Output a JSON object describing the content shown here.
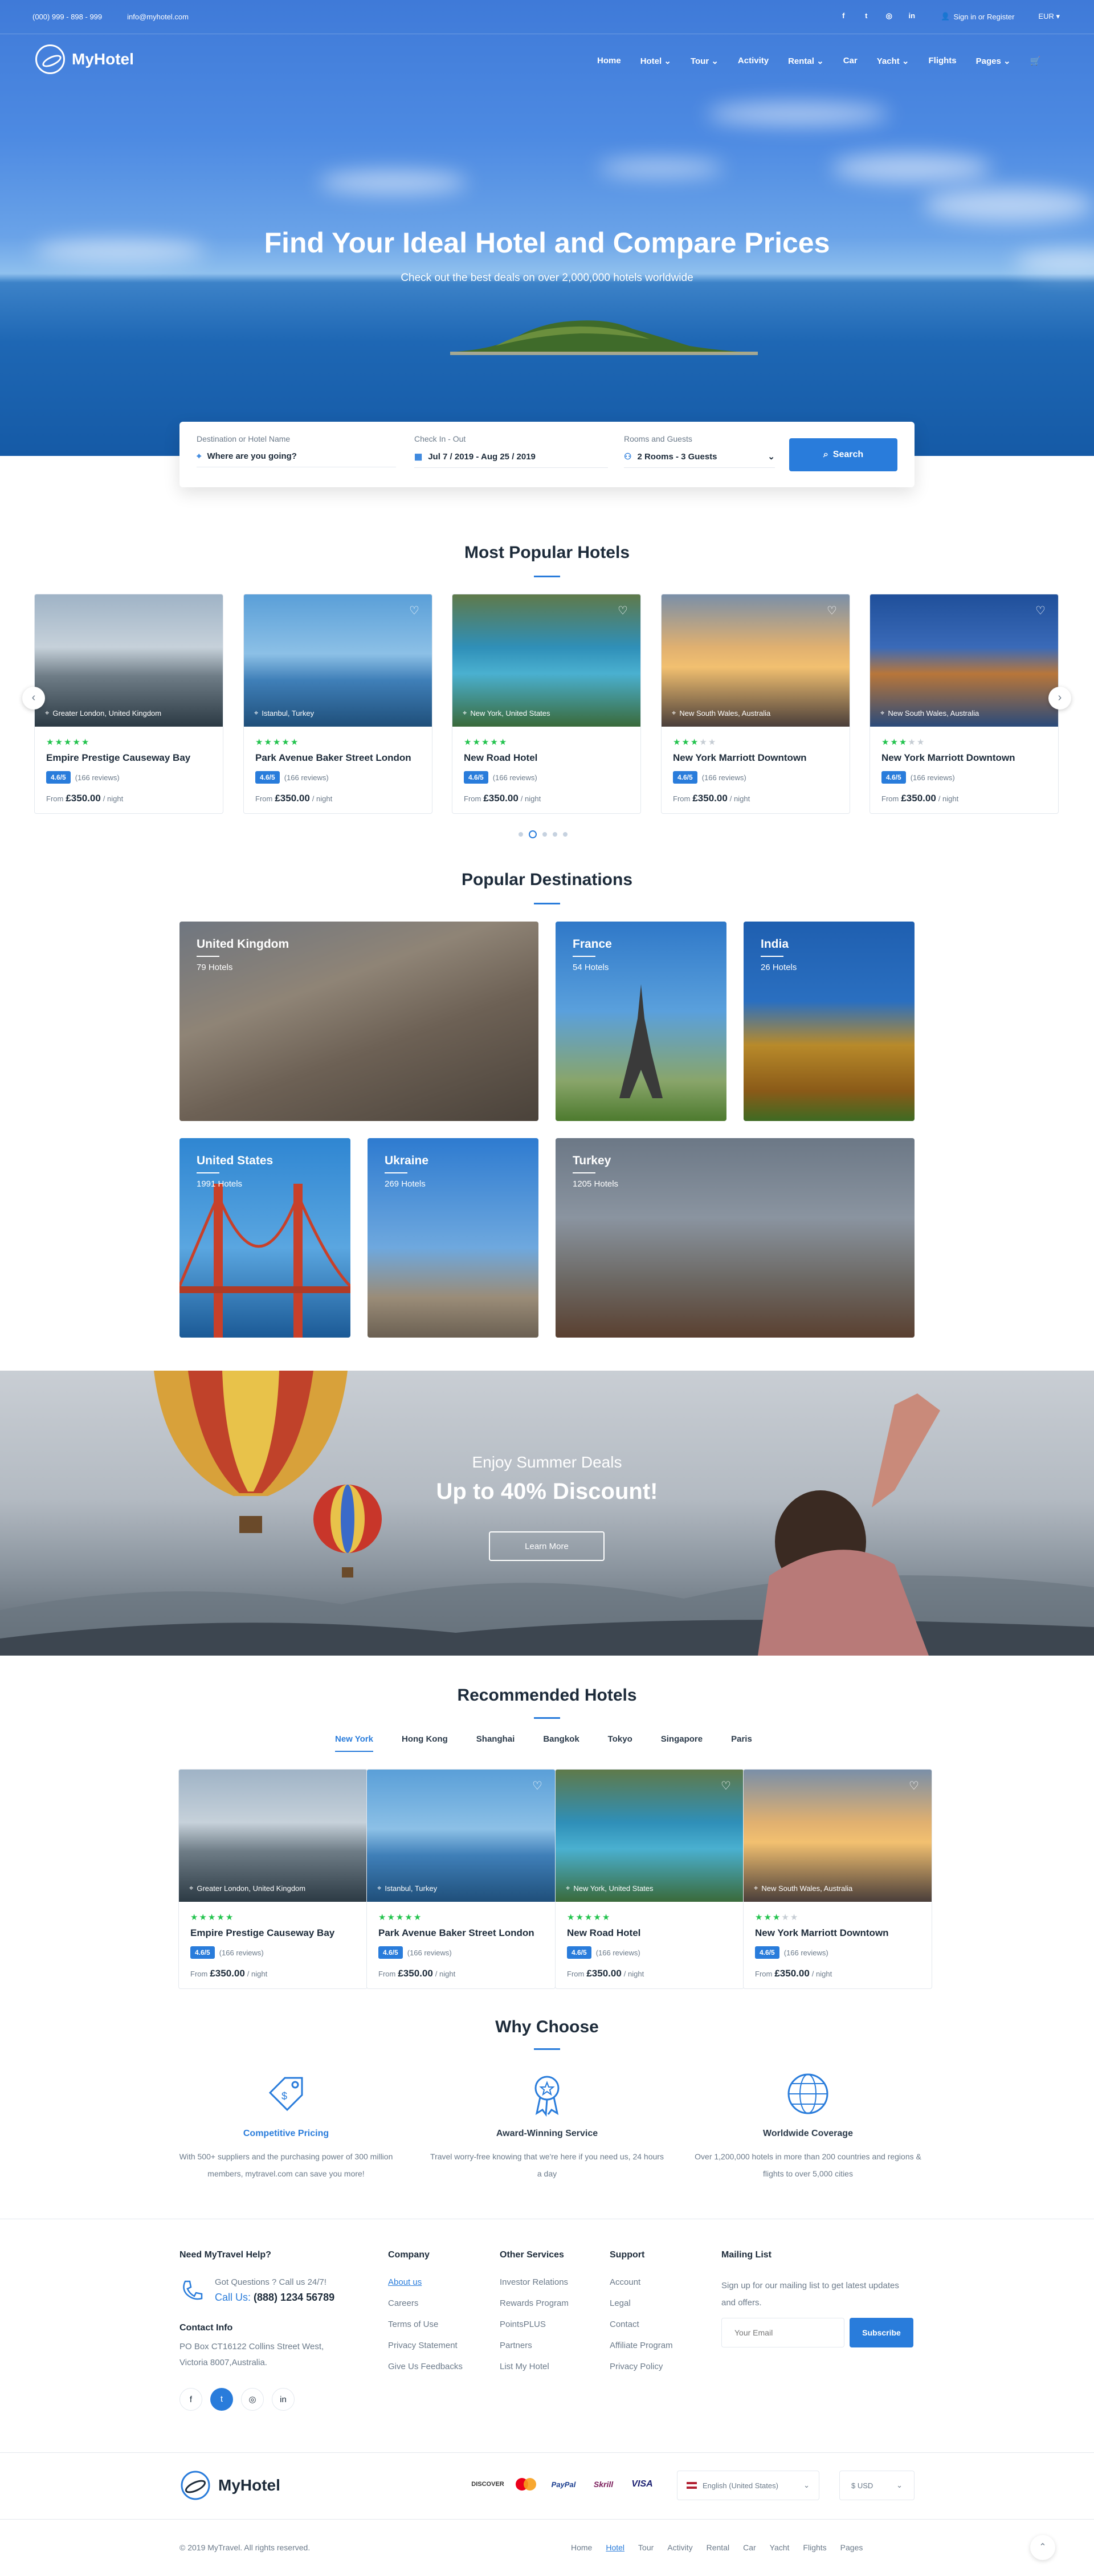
{
  "topbar": {
    "phone": "(000) 999 - 898 - 999",
    "email": "info@myhotel.com",
    "signin": "Sign in or Register",
    "currency": "EUR"
  },
  "brand": {
    "name": "MyHotel"
  },
  "nav": {
    "items": [
      "Home",
      "Hotel",
      "Tour",
      "Activity",
      "Rental",
      "Car",
      "Yacht",
      "Flights",
      "Pages"
    ]
  },
  "hero": {
    "title": "Find Your Ideal Hotel and Compare Prices",
    "subtitle": "Check out the best deals on over 2,000,000 hotels worldwide"
  },
  "search": {
    "dest_label": "Destination or Hotel Name",
    "dest_value": "Where are you going?",
    "date_label": "Check In - Out",
    "date_value": "Jul 7 / 2019 - Aug 25 / 2019",
    "rooms_label": "Rooms and Guests",
    "rooms_value": "2 Rooms - 3 Guests",
    "button": "Search"
  },
  "popular": {
    "title": "Most Popular Hotels",
    "cards": [
      {
        "location": "Greater London, United Kingdom",
        "name": "Empire Prestige Causeway Bay",
        "stars": 5,
        "rating": "4.6/5",
        "reviews": "(166 reviews)",
        "from": "From",
        "price": "£350.00",
        "per": "/ night"
      },
      {
        "location": "Istanbul, Turkey",
        "name": "Park Avenue Baker Street London",
        "stars": 5,
        "rating": "4.6/5",
        "reviews": "(166 reviews)",
        "from": "From",
        "price": "£350.00",
        "per": "/ night"
      },
      {
        "location": "New York, United States",
        "name": "New Road Hotel",
        "stars": 5,
        "rating": "4.6/5",
        "reviews": "(166 reviews)",
        "from": "From",
        "price": "£350.00",
        "per": "/ night"
      },
      {
        "location": "New South Wales, Australia",
        "name": "New York Marriott Downtown",
        "stars": 3,
        "rating": "4.6/5",
        "reviews": "(166 reviews)",
        "from": "From",
        "price": "£350.00",
        "per": "/ night"
      },
      {
        "location": "New South Wales, Australia",
        "name": "New York Marriott Downtown",
        "stars": 3,
        "rating": "4.6/5",
        "reviews": "(166 reviews)",
        "from": "From",
        "price": "£350.00",
        "per": "/ night"
      }
    ]
  },
  "destinations": {
    "title": "Popular Destinations",
    "items": [
      {
        "name": "United Kingdom",
        "count": "79 Hotels"
      },
      {
        "name": "France",
        "count": "54 Hotels"
      },
      {
        "name": "India",
        "count": "26 Hotels"
      },
      {
        "name": "United States",
        "count": "1991 Hotels"
      },
      {
        "name": "Ukraine",
        "count": "269 Hotels"
      },
      {
        "name": "Turkey",
        "count": "1205 Hotels"
      }
    ]
  },
  "banner": {
    "kicker": "Enjoy Summer Deals",
    "title": "Up to 40% Discount!",
    "button": "Learn More"
  },
  "recommended": {
    "title": "Recommended Hotels",
    "tabs": [
      "New York",
      "Hong Kong",
      "Shanghai",
      "Bangkok",
      "Tokyo",
      "Singapore",
      "Paris"
    ],
    "cards": [
      {
        "location": "Greater London, United Kingdom",
        "name": "Empire Prestige Causeway Bay",
        "stars": 5,
        "rating": "4.6/5",
        "reviews": "(166 reviews)",
        "from": "From",
        "price": "£350.00",
        "per": "/ night"
      },
      {
        "location": "Istanbul, Turkey",
        "name": "Park Avenue Baker Street London",
        "stars": 5,
        "rating": "4.6/5",
        "reviews": "(166 reviews)",
        "from": "From",
        "price": "£350.00",
        "per": "/ night"
      },
      {
        "location": "New York, United States",
        "name": "New Road Hotel",
        "stars": 5,
        "rating": "4.6/5",
        "reviews": "(166 reviews)",
        "from": "From",
        "price": "£350.00",
        "per": "/ night"
      },
      {
        "location": "New South Wales, Australia",
        "name": "New York Marriott Downtown",
        "stars": 3,
        "rating": "4.6/5",
        "reviews": "(166 reviews)",
        "from": "From",
        "price": "£350.00",
        "per": "/ night"
      }
    ]
  },
  "why": {
    "title": "Why Choose",
    "items": [
      {
        "title": "Competitive Pricing",
        "desc": "With 500+ suppliers and the purchasing power of 300 million members, mytravel.com can save you more!",
        "icon": "price-tag-icon"
      },
      {
        "title": "Award-Winning Service",
        "desc": "Travel worry-free knowing that we're here if you need us, 24 hours a day",
        "icon": "award-icon"
      },
      {
        "title": "Worldwide Coverage",
        "desc": "Over 1,200,000 hotels in more than 200 countries and regions & flights to over 5,000 cities",
        "icon": "globe-icon"
      }
    ]
  },
  "footer": {
    "help_title": "Need MyTravel Help?",
    "help_q": "Got Questions ? Call us 24/7!",
    "help_call": "Call Us:",
    "help_phone": "(888) 1234 56789",
    "contact_title": "Contact Info",
    "contact_addr1": "PO Box CT16122 Collins Street West,",
    "contact_addr2": "Victoria 8007,Australia.",
    "company_title": "Company",
    "company": [
      "About us",
      "Careers",
      "Terms of Use",
      "Privacy Statement",
      "Give Us Feedbacks"
    ],
    "services_title": "Other Services",
    "services": [
      "Investor Relations",
      "Rewards Program",
      "PointsPLUS",
      "Partners",
      "List My Hotel"
    ],
    "support_title": "Support",
    "support": [
      "Account",
      "Legal",
      "Contact",
      "Affiliate Program",
      "Privacy Policy"
    ],
    "mail_title": "Mailing List",
    "mail_desc": "Sign up for our mailing list to get latest updates and offers.",
    "mail_placeholder": "Your Email",
    "subscribe": "Subscribe",
    "payments": [
      "DISCOVER",
      "mastercard",
      "PayPal",
      "Skrill",
      "VISA"
    ],
    "language": "English (United States)",
    "currency": "$ USD",
    "copyright": "© 2019 MyTravel. All rights reserved.",
    "bottom_nav": [
      "Home",
      "Hotel",
      "Tour",
      "Activity",
      "Rental",
      "Car",
      "Yacht",
      "Flights",
      "Pages"
    ]
  },
  "colors": {
    "accent": "#297cdb",
    "star": "#22c34d",
    "text": "#1d2b3a"
  }
}
